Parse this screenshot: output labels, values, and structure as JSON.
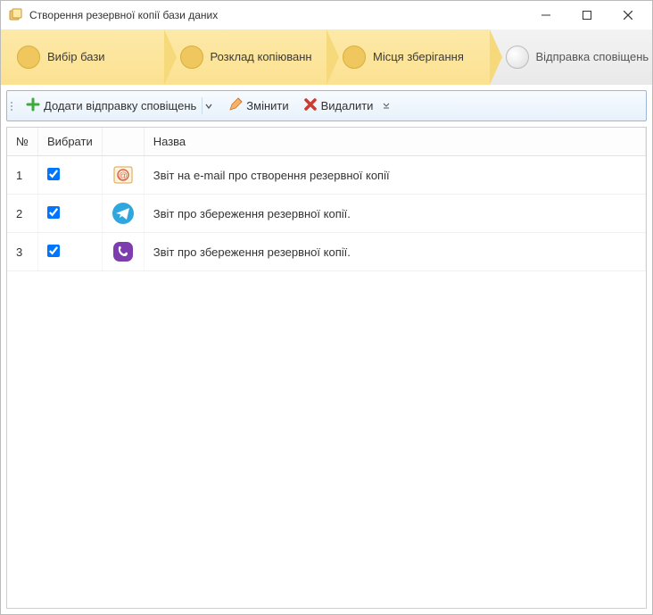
{
  "window": {
    "title": "Створення резервної копії бази даних"
  },
  "steps": {
    "items": [
      {
        "label": "Вибір бази"
      },
      {
        "label": "Розклад копіюванн"
      },
      {
        "label": "Місця зберігання"
      },
      {
        "label": "Відправка сповіщень"
      }
    ]
  },
  "toolbar": {
    "add_label": "Додати відправку сповіщень",
    "edit_label": "Змінити",
    "delete_label": "Видалити"
  },
  "table": {
    "headers": {
      "num": "№",
      "select": "Вибрати",
      "name": "Назва"
    },
    "rows": [
      {
        "num": "1",
        "checked": true,
        "icon": "email",
        "name": "Звіт на e-mail про створення резервної копії"
      },
      {
        "num": "2",
        "checked": true,
        "icon": "telegram",
        "name": "Звіт про збереження резервної копії."
      },
      {
        "num": "3",
        "checked": true,
        "icon": "viber",
        "name": "Звіт про збереження резервної копії."
      }
    ]
  }
}
